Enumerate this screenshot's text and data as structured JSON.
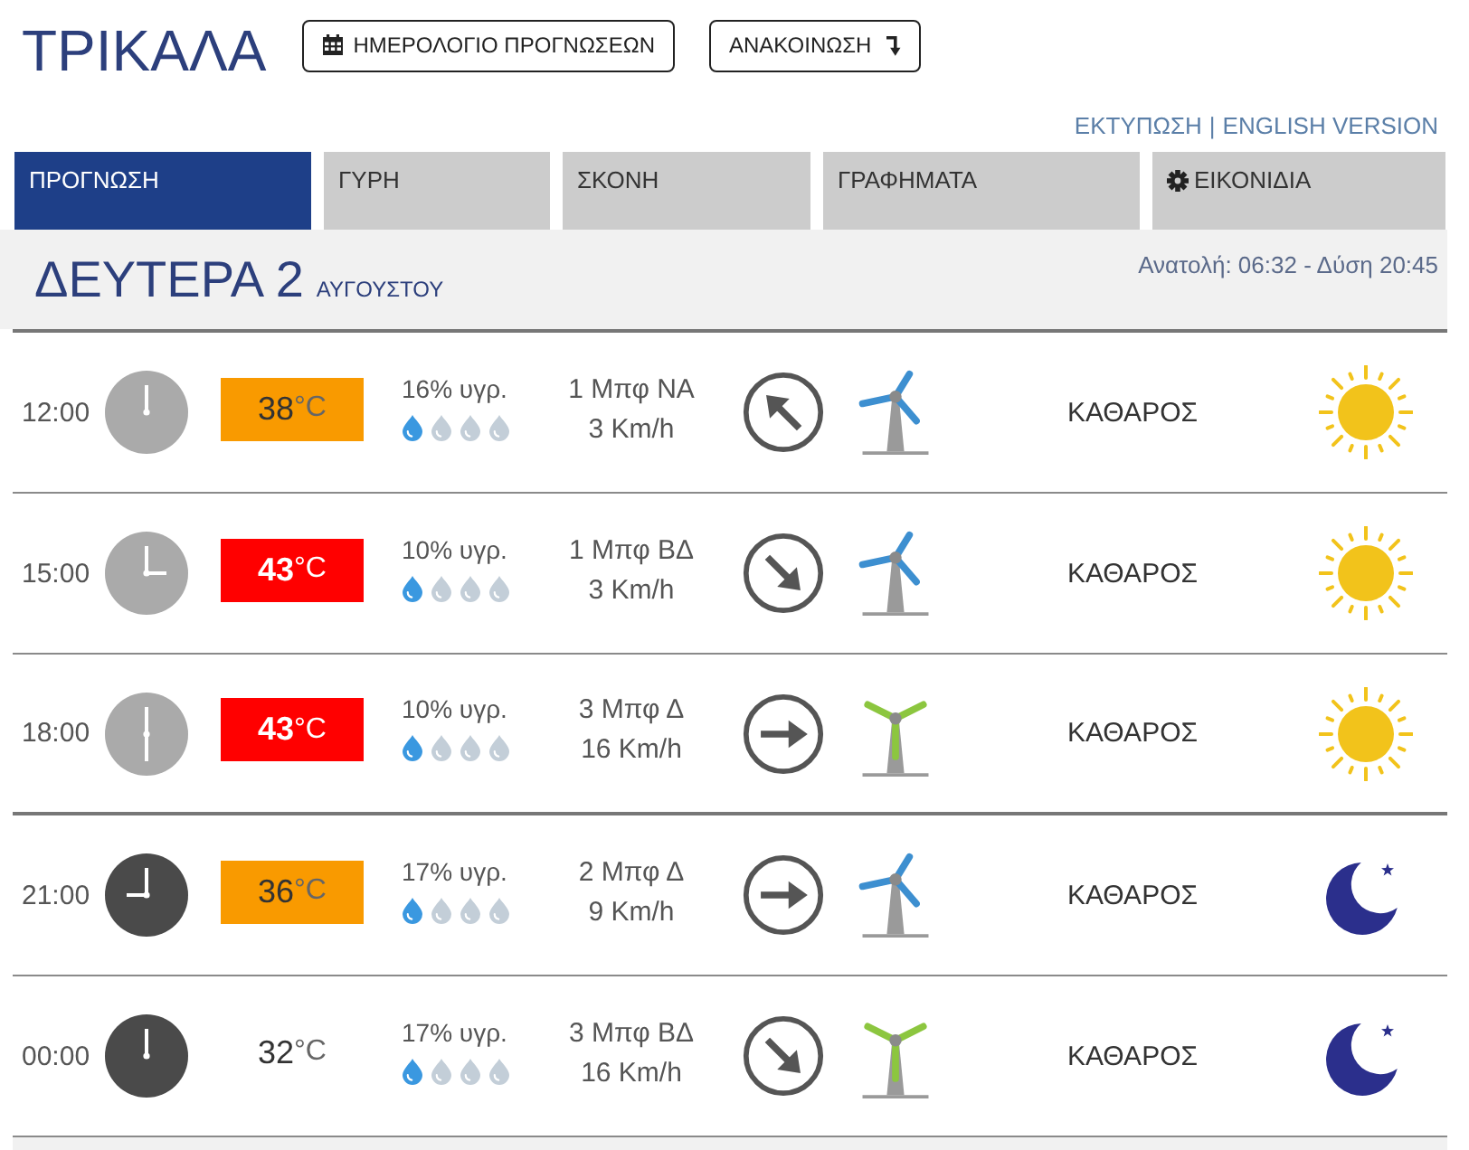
{
  "header": {
    "title": "ΤΡΙΚΑΛΑ",
    "buttons": [
      {
        "label": "ΗΜΕΡΟΛΟΓΙΟ ΠΡΟΓΝΩΣΕΩΝ"
      },
      {
        "label": "ΑΝΑΚΟΙΝΩΣΗ"
      }
    ]
  },
  "links": {
    "items": [
      "ΕΚΤΥΠΩΣΗ",
      "ENGLISH VERSION"
    ],
    "separator": "|"
  },
  "tabs": [
    {
      "label": "ΠΡΟΓΝΩΣΗ",
      "selected": true
    },
    {
      "label": "ΓΥΡΗ",
      "selected": false
    },
    {
      "label": "ΣΚΟΝΗ",
      "selected": false
    },
    {
      "label": "ΓΡΑΦΗΜΑΤΑ",
      "selected": false
    },
    {
      "label": "ΕΙΚΟΝΙΔΙΑ",
      "selected": false
    }
  ],
  "day": {
    "date": "ΔΕΥΤΕΡΑ 2",
    "month": "ΑΥΓΟΥΣΤΟΥ",
    "sun_times": "Ανατολή: 06:32 - Δύση 20:45"
  },
  "rows": [
    {
      "time": "12:00",
      "clock": {
        "kind": "up",
        "night": false
      },
      "temperature": {
        "value": "38",
        "unit": "°C",
        "kind": "warm"
      },
      "humidity": "16% υγρ.",
      "stars": 1,
      "wind_force": "1 Μπφ ΝΑ",
      "wind_speed": "3 Km/h",
      "wind_arrow": {
        "kind": "up-left"
      },
      "turbine": {
        "kind": "light"
      },
      "condition": "ΚΑΘΑΡΟΣ",
      "sky": {
        "kind": "sun"
      }
    },
    {
      "time": "15:00",
      "clock": {
        "kind": "right",
        "night": false
      },
      "temperature": {
        "value": "43",
        "unit": "°C",
        "kind": "hot"
      },
      "humidity": "10% υγρ.",
      "stars": 1,
      "wind_force": "1 Μπφ ΒΔ",
      "wind_speed": "3 Km/h",
      "wind_arrow": {
        "kind": "down-right"
      },
      "turbine": {
        "kind": "light"
      },
      "condition": "ΚΑΘΑΡΟΣ",
      "sky": {
        "kind": "sun"
      }
    },
    {
      "time": "18:00",
      "clock": {
        "kind": "down",
        "night": false
      },
      "temperature": {
        "value": "43",
        "unit": "°C",
        "kind": "hot"
      },
      "humidity": "10% υγρ.",
      "stars": 1,
      "wind_force": "3 Μπφ Δ",
      "wind_speed": "16 Km/h",
      "wind_arrow": {
        "kind": "right"
      },
      "turbine": {
        "kind": "strong"
      },
      "condition": "ΚΑΘΑΡΟΣ",
      "sky": {
        "kind": "sun"
      }
    },
    {
      "time": "21:00",
      "clock": {
        "kind": "left",
        "night": true
      },
      "temperature": {
        "value": "36",
        "unit": "°C",
        "kind": "warm"
      },
      "humidity": "17% υγρ.",
      "stars": 1,
      "wind_force": "2 Μπφ Δ",
      "wind_speed": "9 Km/h",
      "wind_arrow": {
        "kind": "right"
      },
      "turbine": {
        "kind": "light"
      },
      "condition": "ΚΑΘΑΡΟΣ",
      "sky": {
        "kind": "moon"
      }
    },
    {
      "time": "00:00",
      "clock": {
        "kind": "up",
        "night": true
      },
      "temperature": {
        "value": "32",
        "unit": "°C",
        "kind": "normal"
      },
      "humidity": "17% υγρ.",
      "stars": 1,
      "wind_force": "3 Μπφ ΒΔ",
      "wind_speed": "16 Km/h",
      "wind_arrow": {
        "kind": "down-right"
      },
      "turbine": {
        "kind": "strong"
      },
      "condition": "ΚΑΘΑΡΟΣ",
      "sky": {
        "kind": "moon"
      }
    }
  ]
}
